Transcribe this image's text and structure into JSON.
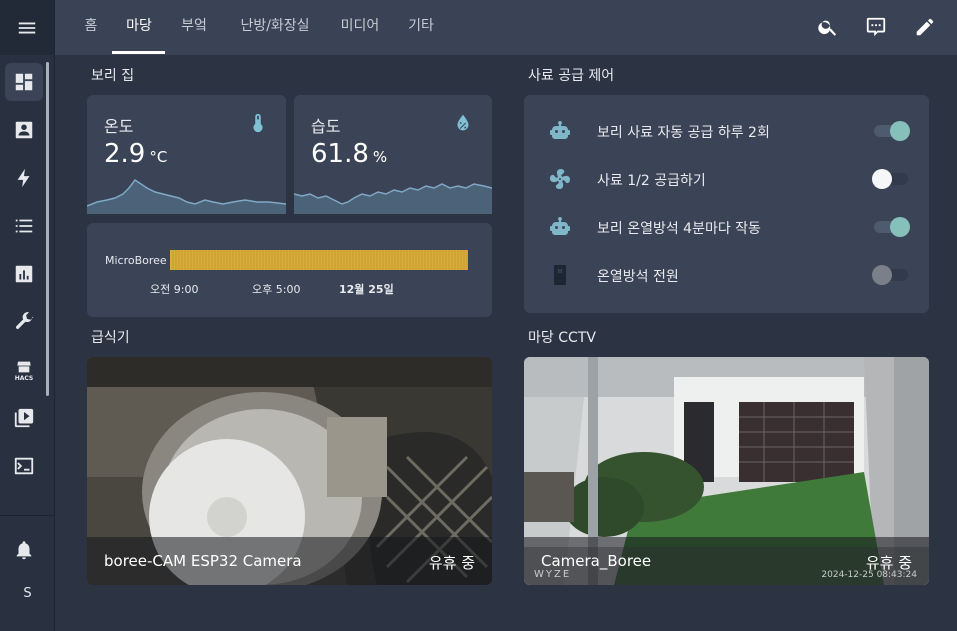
{
  "sidebar": {
    "initial": "S",
    "hacs_label": "HACS",
    "items": [
      "dashboard-icon",
      "person-card-icon",
      "lightning-icon",
      "list-icon",
      "chart-icon",
      "wrench-icon",
      "hacs-store-icon",
      "media-icon",
      "terminal-icon",
      "bell-icon"
    ]
  },
  "tabs": [
    {
      "label": "홈",
      "active": false
    },
    {
      "label": "마당",
      "active": true
    },
    {
      "label": "부엌",
      "active": false
    },
    {
      "label": "난방/화장실",
      "active": false
    },
    {
      "label": "미디어",
      "active": false
    },
    {
      "label": "기타",
      "active": false
    }
  ],
  "toolbar_icons": [
    "search-icon",
    "assist-icon",
    "pencil-icon"
  ],
  "boree_house": {
    "title": "보리 집",
    "temperature": {
      "name": "온도",
      "value": "2.9",
      "unit": "°C"
    },
    "humidity": {
      "name": "습도",
      "value": "61.8",
      "unit": "%"
    },
    "timeline": {
      "entity": "MicroBoree",
      "bar_color": "#d9ad3b",
      "ticks": [
        "오전 9:00",
        "오후 5:00",
        "12월 25일"
      ]
    }
  },
  "feed_control": {
    "title": "사료 공급 제어",
    "rows": [
      {
        "label": "보리 사료 자동 공급 하루 2회",
        "icon": "robot-icon",
        "on": true
      },
      {
        "label": "사료 1/2 공급하기",
        "icon": "fan-icon",
        "on": false
      },
      {
        "label": "보리 온열방석 4분마다 작동",
        "icon": "robot-icon",
        "on": true
      },
      {
        "label": "온열방석 전원",
        "icon": "plug-icon",
        "on": false
      }
    ]
  },
  "feeder": {
    "title": "급식기",
    "camera_name": "boree-CAM ESP32 Camera",
    "state": "유휴 중"
  },
  "yard_cctv": {
    "title": "마당 CCTV",
    "camera_name": "Camera_Boree",
    "state": "유휴 중",
    "brand": "WYZE",
    "timestamp": "2024-12-25 08:43:24"
  }
}
